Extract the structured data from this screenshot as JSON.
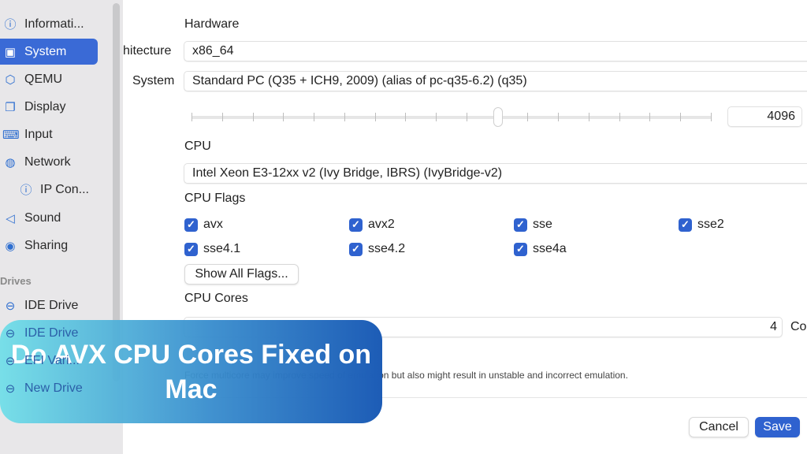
{
  "sidebar": {
    "items": [
      {
        "label": "Informati...",
        "icon": "info-icon"
      },
      {
        "label": "System",
        "icon": "chip-icon",
        "active": true
      },
      {
        "label": "QEMU",
        "icon": "cube-icon"
      },
      {
        "label": "Display",
        "icon": "display-icon"
      },
      {
        "label": "Input",
        "icon": "keyboard-icon"
      },
      {
        "label": "Network",
        "icon": "globe-icon"
      },
      {
        "label": "IP Con...",
        "icon": "info-icon"
      },
      {
        "label": "Sound",
        "icon": "speaker-icon"
      },
      {
        "label": "Sharing",
        "icon": "person-icon"
      }
    ],
    "drives_header": "Drives",
    "drives": [
      {
        "label": "IDE Drive"
      },
      {
        "label": "IDE Drive"
      },
      {
        "label": "EFI Vari..."
      },
      {
        "label": "New Drive"
      }
    ]
  },
  "main": {
    "hardware_header": "Hardware",
    "architecture_label": "hitecture",
    "architecture_value": "x86_64",
    "system_label": "System",
    "system_value": "Standard PC (Q35 + ICH9, 2009) (alias of pc-q35-6.2) (q35)",
    "memory_value": "4096",
    "memory_slider_fraction": 0.59,
    "cpu_label": "CPU",
    "cpu_value": "Intel Xeon E3-12xx v2 (Ivy Bridge, IBRS) (IvyBridge-v2)",
    "cpu_flags_label": "CPU Flags",
    "flags": [
      {
        "label": "avx",
        "checked": true
      },
      {
        "label": "avx2",
        "checked": true
      },
      {
        "label": "sse",
        "checked": true
      },
      {
        "label": "sse2",
        "checked": true
      },
      {
        "label": "sse4.1",
        "checked": true
      },
      {
        "label": "sse4.2",
        "checked": true
      },
      {
        "label": "sse4a",
        "checked": true
      }
    ],
    "show_all_flags": "Show All Flags...",
    "cpu_cores_label": "CPU Cores",
    "cpu_cores_value": "4",
    "cores_suffix": "Co",
    "multicore_note": "Force multicore may improve speed of emulation but also might result in unstable and incorrect emulation.",
    "cancel": "Cancel",
    "save": "Save"
  },
  "banner": {
    "line1": "Do AVX CPU Cores Fixed on",
    "line2": "Mac"
  },
  "colors": {
    "accent": "#3a6ad6",
    "banner_start": "#6edee8",
    "banner_end": "#1d5cb6"
  }
}
